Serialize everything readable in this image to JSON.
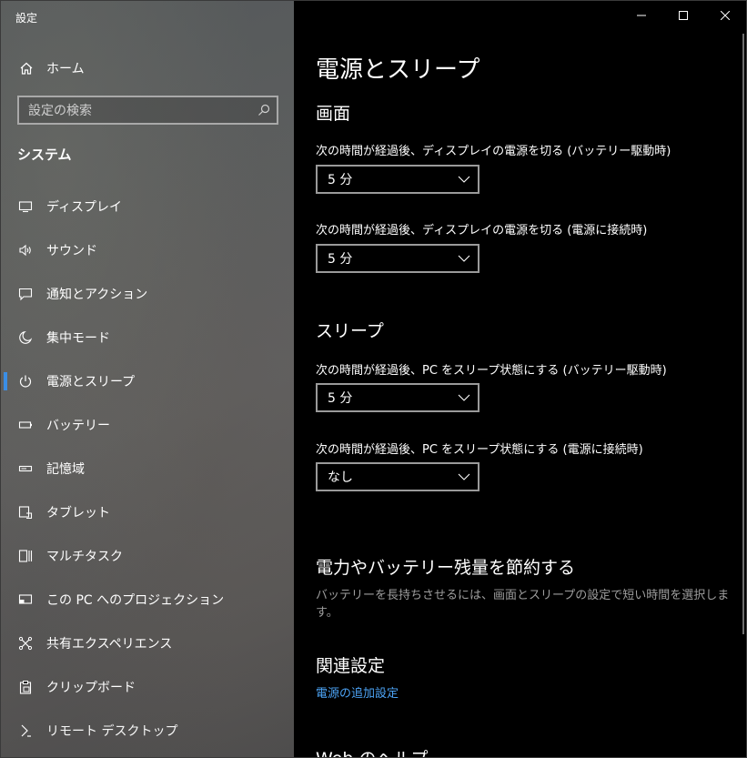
{
  "app": {
    "title": "設定"
  },
  "sidebar": {
    "home_label": "ホーム",
    "search_placeholder": "設定の検索",
    "section": "システム",
    "items": [
      {
        "label": "ディスプレイ",
        "icon": "monitor-icon"
      },
      {
        "label": "サウンド",
        "icon": "speaker-icon"
      },
      {
        "label": "通知とアクション",
        "icon": "message-icon"
      },
      {
        "label": "集中モード",
        "icon": "moon-icon"
      },
      {
        "label": "電源とスリープ",
        "icon": "power-icon",
        "active": true
      },
      {
        "label": "バッテリー",
        "icon": "battery-icon"
      },
      {
        "label": "記憶域",
        "icon": "storage-icon"
      },
      {
        "label": "タブレット",
        "icon": "tablet-icon"
      },
      {
        "label": "マルチタスク",
        "icon": "multitask-icon"
      },
      {
        "label": "この PC へのプロジェクション",
        "icon": "projection-icon"
      },
      {
        "label": "共有エクスペリエンス",
        "icon": "share-icon"
      },
      {
        "label": "クリップボード",
        "icon": "clipboard-icon"
      },
      {
        "label": "リモート デスクトップ",
        "icon": "remote-desktop-icon"
      }
    ]
  },
  "main": {
    "title": "電源とスリープ",
    "screen": {
      "heading": "画面",
      "battery_label": "次の時間が経過後、ディスプレイの電源を切る (バッテリー駆動時)",
      "battery_value": "5 分",
      "plugged_label": "次の時間が経過後、ディスプレイの電源を切る (電源に接続時)",
      "plugged_value": "5 分"
    },
    "sleep": {
      "heading": "スリープ",
      "battery_label": "次の時間が経過後、PC をスリープ状態にする (バッテリー駆動時)",
      "battery_value": "5 分",
      "plugged_label": "次の時間が経過後、PC をスリープ状態にする (電源に接続時)",
      "plugged_value": "なし"
    },
    "save": {
      "heading": "電力やバッテリー残量を節約する",
      "description": "バッテリーを長持ちさせるには、画面とスリープの設定で短い時間を選択します。"
    },
    "related": {
      "heading": "関連設定",
      "link": "電源の追加設定"
    },
    "web_help": {
      "heading": "Web のヘルプ"
    }
  },
  "colors": {
    "accent": "#3a8ee6",
    "link": "#4ca3f5",
    "background": "#000000"
  }
}
